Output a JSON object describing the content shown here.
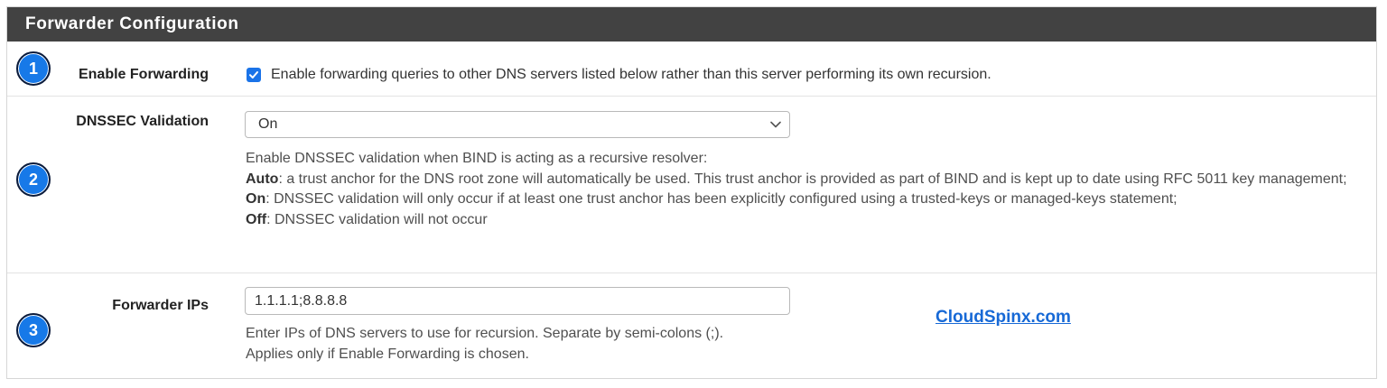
{
  "panel": {
    "title": "Forwarder Configuration"
  },
  "rows": {
    "enable_forwarding": {
      "badge": "1",
      "label": "Enable Forwarding",
      "checked": true,
      "checkbox_text": "Enable forwarding queries to other DNS servers listed below rather than this server performing its own recursion."
    },
    "dnssec_validation": {
      "badge": "2",
      "label": "DNSSEC Validation",
      "selected_value": "On",
      "help_intro": "Enable DNSSEC validation when BIND is acting as a recursive resolver:",
      "auto_term": "Auto",
      "auto_desc": ": a trust anchor for the DNS root zone will automatically be used. This trust anchor is provided as part of BIND and is kept up to date using RFC 5011 key management;",
      "on_term": "On",
      "on_desc": ": DNSSEC validation will only occur if at least one trust anchor has been explicitly configured using a trusted-keys or managed-keys statement;",
      "off_term": "Off",
      "off_desc": ": DNSSEC validation will not occur"
    },
    "forwarder_ips": {
      "badge": "3",
      "label": "Forwarder IPs",
      "value": "1.1.1.1;8.8.8.8",
      "help_line1": "Enter IPs of DNS servers to use for recursion. Separate by semi-colons (;).",
      "help_line2": "Applies only if Enable Forwarding is chosen."
    }
  },
  "watermark": {
    "text": "CloudSpinx.com"
  },
  "colors": {
    "heading_bg": "#424242",
    "badge_blue": "#1779e8",
    "checkbox_blue": "#1a73e8",
    "link_blue": "#1769d6"
  },
  "icons": {
    "checkbox": "checkmark-icon",
    "select": "chevron-down-icon"
  }
}
